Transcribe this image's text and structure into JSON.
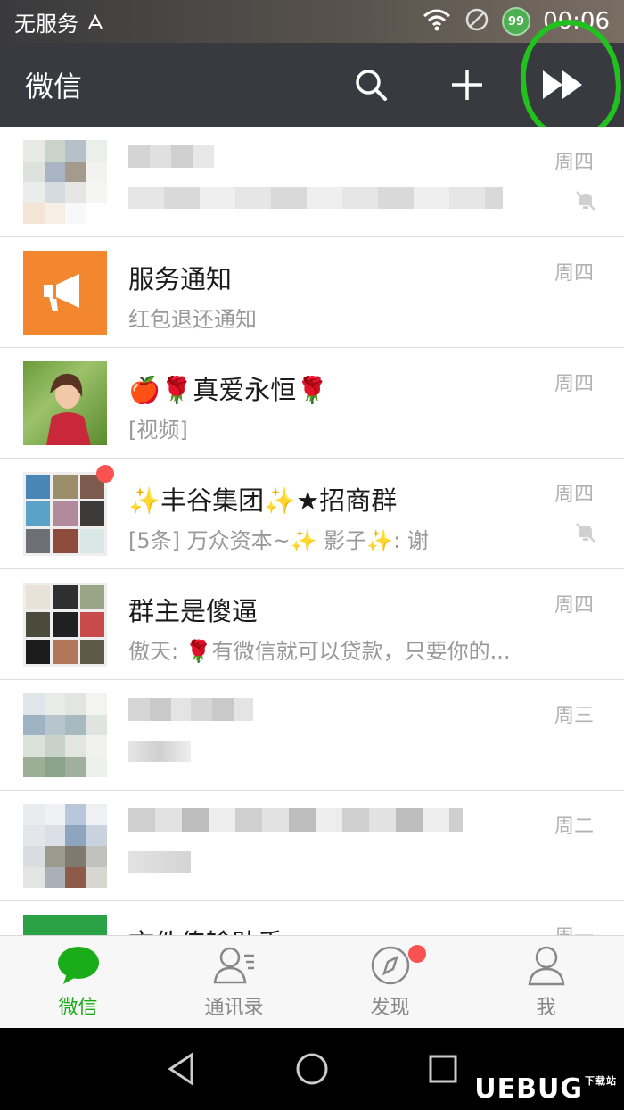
{
  "status_bar": {
    "carrier": "无服务",
    "battery": "99",
    "time": "00:06"
  },
  "app_bar": {
    "title": "微信",
    "icons": [
      "search-icon",
      "add-icon",
      "forward-icon"
    ]
  },
  "chats": [
    {
      "name": "",
      "message": "",
      "time": "周四",
      "muted": true,
      "avatar": "pixelated"
    },
    {
      "name": "服务通知",
      "message": "红包退还通知",
      "time": "周四",
      "muted": false,
      "avatar": "megaphone",
      "avatar_color": "#f2872f"
    },
    {
      "name": "🍎🌹真爱永恒🌹",
      "message": "[视频]",
      "time": "周四",
      "muted": false,
      "avatar": "photo"
    },
    {
      "name": "✨丰谷集团✨★招商群",
      "message": "[5条] 万众资本~✨ 影子✨: 谢",
      "time": "周四",
      "muted": true,
      "avatar": "group",
      "unread_dot": true
    },
    {
      "name": "群主是傻逼",
      "message": "傲天: 🌹有微信就可以贷款，只要你的...",
      "time": "周四",
      "muted": false,
      "avatar": "group"
    },
    {
      "name": "",
      "message": "",
      "time": "周三",
      "muted": false,
      "avatar": "pixelated"
    },
    {
      "name": "",
      "message": "",
      "time": "周二",
      "muted": false,
      "avatar": "pixelated"
    },
    {
      "name": "文件传输助手",
      "message": "",
      "time": "周一",
      "muted": false,
      "avatar": "file",
      "avatar_color": "#2ba245"
    }
  ],
  "tabs": [
    {
      "label": "微信",
      "icon": "chat-bubble-icon",
      "active": true
    },
    {
      "label": "通讯录",
      "icon": "contacts-icon",
      "active": false
    },
    {
      "label": "发现",
      "icon": "compass-icon",
      "active": false,
      "badge": true
    },
    {
      "label": "我",
      "icon": "profile-icon",
      "active": false
    }
  ],
  "watermark": "UEBUG",
  "watermark_sub": "下载站",
  "colors": {
    "accent": "#1aad19",
    "header": "#393a3f",
    "annotation": "#21c21e",
    "badge": "#fa5151"
  }
}
